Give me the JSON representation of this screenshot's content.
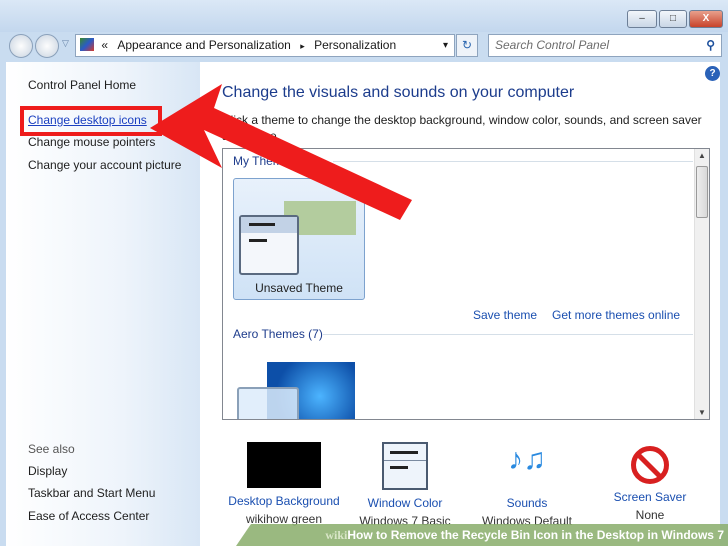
{
  "window": {
    "minimize": "–",
    "maximize": "□",
    "close": "X"
  },
  "address": {
    "chevrons": "«",
    "crumbs": [
      "Appearance and Personalization",
      "Personalization"
    ],
    "separator": "▸",
    "dropdown": "▾",
    "refresh": "↻"
  },
  "search": {
    "placeholder": "Search Control Panel",
    "icon": "⚲"
  },
  "sidebar": {
    "home": "Control Panel Home",
    "items": [
      "Change desktop icons",
      "Change mouse pointers",
      "Change your account picture"
    ],
    "see_also": "See also",
    "see_also_items": [
      "Display",
      "Taskbar and Start Menu",
      "Ease of Access Center"
    ]
  },
  "main": {
    "help": "?",
    "heading": "Change the visuals and sounds on your computer",
    "description": "Click a theme to change the desktop background, window color, sounds, and screen saver all at once.",
    "my_themes": "My Themes (1)",
    "unsaved_theme": "Unsaved Theme",
    "save_theme": "Save theme",
    "get_more": "Get more themes online",
    "aero_themes": "Aero Themes (7)"
  },
  "bottom": [
    {
      "label": "Desktop Background",
      "value": "wikihow green"
    },
    {
      "label": "Window Color",
      "value": "Windows 7 Basic"
    },
    {
      "label": "Sounds",
      "value": "Windows Default"
    },
    {
      "label": "Screen Saver",
      "value": "None"
    }
  ],
  "banner": {
    "wiki": "wiki",
    "how": "How",
    "title": " to Remove the Recycle Bin Icon in the Desktop in Windows 7"
  },
  "colors": {
    "annotation": "#ee1c1c",
    "link": "#1a4fb0"
  }
}
